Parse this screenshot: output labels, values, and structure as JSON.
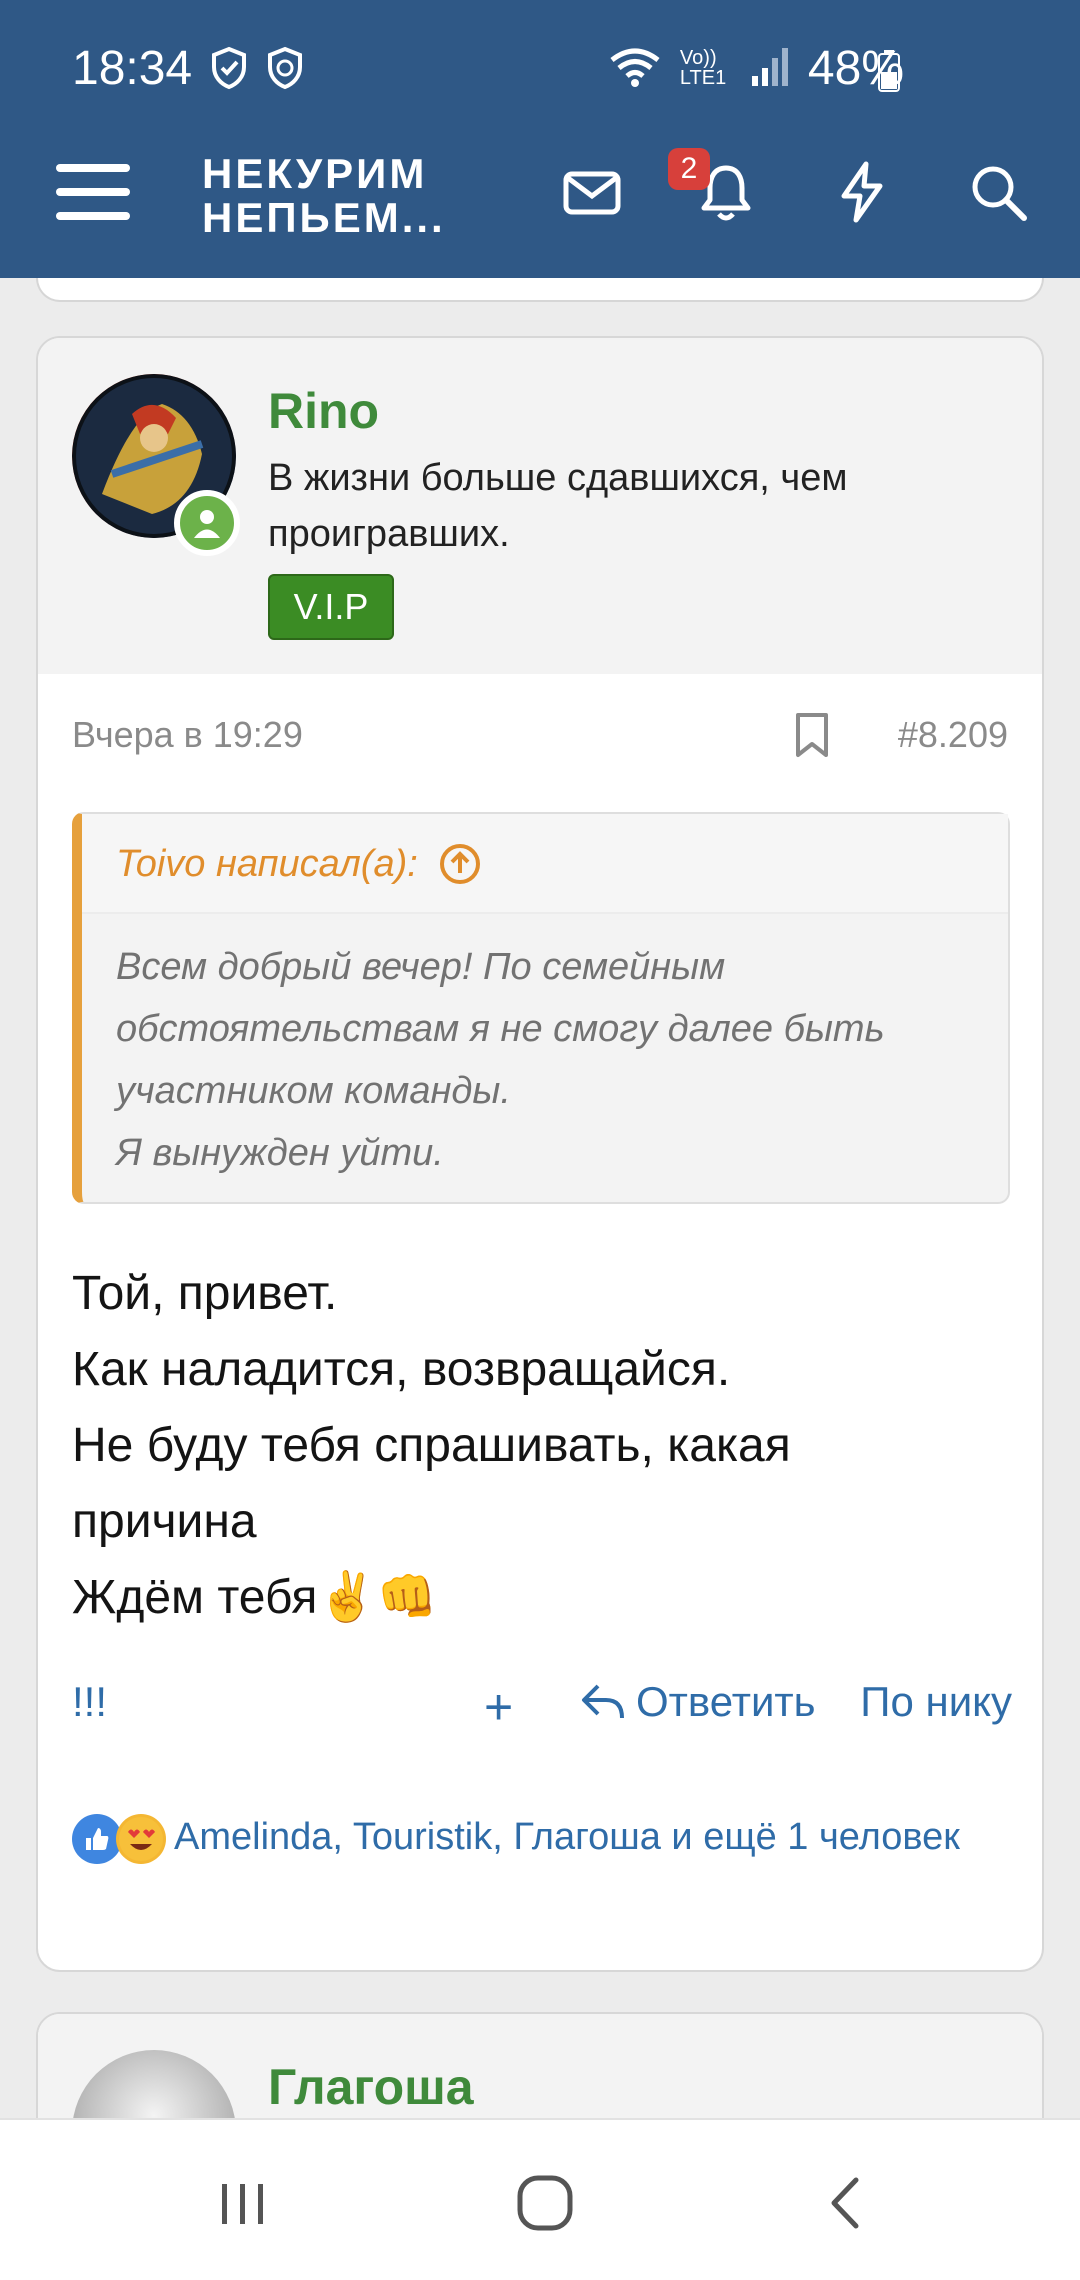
{
  "status_bar": {
    "time": "18:34",
    "network": "Vo)) LTE1",
    "battery": "48%"
  },
  "header": {
    "logo_line1": "НЕКУРИМ",
    "logo_line2": "НЕПЬЕМ...",
    "notification_count": "2"
  },
  "post": {
    "username": "Rino",
    "user_title": "В жизни больше сдавшихся, чем проигравших.",
    "badge": "V.I.P",
    "date": "Вчера в 19:29",
    "number": "#8.209",
    "quote": {
      "author": "Toivo написал(а):",
      "line1": "Всем добрый вечер! По семейным",
      "line2": "обстоятельствам я не смогу далее быть",
      "line3": "участником команды.",
      "line4": "Я вынужден уйти."
    },
    "body": {
      "line1": "Той, привет.",
      "line2": "Как наладится, возвращайся.",
      "line3": "Не буду тебя спрашивать, какая",
      "line4": "причина",
      "line5": "Ждём тебя✌️👊"
    },
    "actions": {
      "exclaim": "!!!",
      "plus": "+",
      "reply": "Ответить",
      "by_nick": "По нику"
    },
    "reactions_text": "Amelinda, Touristik, Глагоша и ещё 1 человек"
  },
  "next_post": {
    "username": "Глагоша"
  },
  "colors": {
    "header_bg": "#2f5886",
    "username": "#3f8a3b",
    "quote_accent": "#e08d2c",
    "link": "#2f6ca8",
    "badge_bg": "#3b8c24"
  }
}
